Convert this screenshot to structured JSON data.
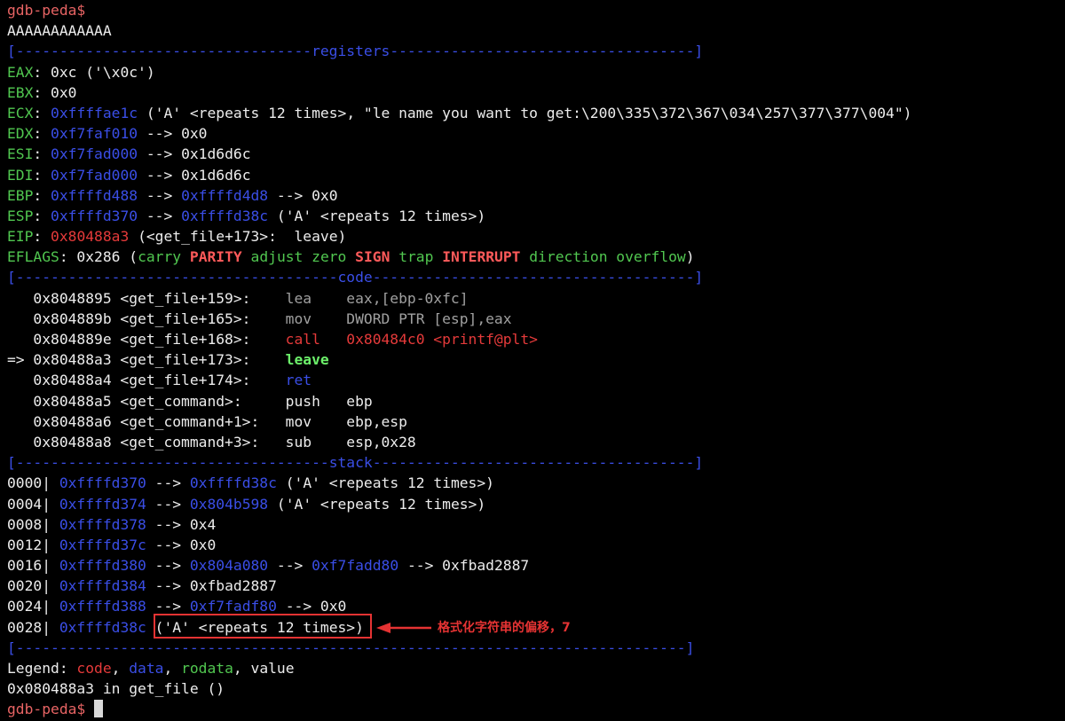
{
  "colors": {
    "default": "#ececec",
    "prompt": "#e86464",
    "green": "#51c750",
    "blue": "#3a4ee6",
    "red": "#e53a3a",
    "dim": "#a0a0a0",
    "bright_green": "#6cf06a",
    "bright_red": "#ff5a5a",
    "annotation": "#e53333"
  },
  "lines": [
    {
      "name": "prompt-line",
      "segs": [
        {
          "t": "gdb-peda$",
          "c": "prompt"
        }
      ]
    },
    {
      "name": "input-echo-line",
      "segs": [
        {
          "t": "AAAAAAAAAAAA",
          "c": "default"
        }
      ]
    },
    {
      "name": "registers-header",
      "segs": [
        {
          "t": "[----------------------------------",
          "c": "blue"
        },
        {
          "t": "registers",
          "c": "blue"
        },
        {
          "t": "-----------------------------------]",
          "c": "blue"
        }
      ]
    },
    {
      "name": "register-eax",
      "segs": [
        {
          "t": "EAX",
          "c": "green"
        },
        {
          "t": ": 0xc ('\\x0c')",
          "c": "default"
        }
      ]
    },
    {
      "name": "register-ebx",
      "segs": [
        {
          "t": "EBX",
          "c": "green"
        },
        {
          "t": ": 0x0",
          "c": "default"
        }
      ]
    },
    {
      "name": "register-ecx",
      "segs": [
        {
          "t": "ECX",
          "c": "green"
        },
        {
          "t": ": ",
          "c": "default"
        },
        {
          "t": "0xffffae1c",
          "c": "blue"
        },
        {
          "t": " ('A' <repeats 12 times>, \"le name you want to get:\\200\\335\\372\\367\\034\\257\\377\\377\\004\")",
          "c": "default"
        }
      ]
    },
    {
      "name": "register-edx",
      "segs": [
        {
          "t": "EDX",
          "c": "green"
        },
        {
          "t": ": ",
          "c": "default"
        },
        {
          "t": "0xf7faf010",
          "c": "blue"
        },
        {
          "t": " --> 0x0",
          "c": "default"
        }
      ]
    },
    {
      "name": "register-esi",
      "segs": [
        {
          "t": "ESI",
          "c": "green"
        },
        {
          "t": ": ",
          "c": "default"
        },
        {
          "t": "0xf7fad000",
          "c": "blue"
        },
        {
          "t": " --> 0x1d6d6c",
          "c": "default"
        }
      ]
    },
    {
      "name": "register-edi",
      "segs": [
        {
          "t": "EDI",
          "c": "green"
        },
        {
          "t": ": ",
          "c": "default"
        },
        {
          "t": "0xf7fad000",
          "c": "blue"
        },
        {
          "t": " --> 0x1d6d6c",
          "c": "default"
        }
      ]
    },
    {
      "name": "register-ebp",
      "segs": [
        {
          "t": "EBP",
          "c": "green"
        },
        {
          "t": ": ",
          "c": "default"
        },
        {
          "t": "0xffffd488",
          "c": "blue"
        },
        {
          "t": " --> ",
          "c": "default"
        },
        {
          "t": "0xffffd4d8",
          "c": "blue"
        },
        {
          "t": " --> 0x0",
          "c": "default"
        }
      ]
    },
    {
      "name": "register-esp",
      "segs": [
        {
          "t": "ESP",
          "c": "green"
        },
        {
          "t": ": ",
          "c": "default"
        },
        {
          "t": "0xffffd370",
          "c": "blue"
        },
        {
          "t": " --> ",
          "c": "default"
        },
        {
          "t": "0xffffd38c",
          "c": "blue"
        },
        {
          "t": " ('A' <repeats 12 times>)",
          "c": "default"
        }
      ]
    },
    {
      "name": "register-eip",
      "segs": [
        {
          "t": "EIP",
          "c": "green"
        },
        {
          "t": ": ",
          "c": "default"
        },
        {
          "t": "0x80488a3",
          "c": "red"
        },
        {
          "t": " (<get_file+173>:  leave)",
          "c": "default"
        }
      ]
    },
    {
      "name": "register-eflags",
      "segs": [
        {
          "t": "EFLAGS",
          "c": "green"
        },
        {
          "t": ": 0x286 (",
          "c": "default"
        },
        {
          "t": "carry",
          "c": "green"
        },
        {
          "t": " ",
          "c": "default"
        },
        {
          "t": "PARITY",
          "c": "bright_red",
          "b": true
        },
        {
          "t": " ",
          "c": "default"
        },
        {
          "t": "adjust zero",
          "c": "green"
        },
        {
          "t": " ",
          "c": "default"
        },
        {
          "t": "SIGN",
          "c": "bright_red",
          "b": true
        },
        {
          "t": " ",
          "c": "default"
        },
        {
          "t": "trap",
          "c": "green"
        },
        {
          "t": " ",
          "c": "default"
        },
        {
          "t": "INTERRUPT",
          "c": "bright_red",
          "b": true
        },
        {
          "t": " ",
          "c": "default"
        },
        {
          "t": "direction overflow",
          "c": "green"
        },
        {
          "t": ")",
          "c": "default"
        }
      ]
    },
    {
      "name": "code-header",
      "segs": [
        {
          "t": "[-------------------------------------",
          "c": "blue"
        },
        {
          "t": "code",
          "c": "blue"
        },
        {
          "t": "-------------------------------------]",
          "c": "blue"
        }
      ]
    },
    {
      "name": "code-line",
      "segs": [
        {
          "t": "   0x8048895 <get_file+159>:    ",
          "c": "default"
        },
        {
          "t": "lea    eax,[ebp-0xfc]",
          "c": "dim"
        }
      ]
    },
    {
      "name": "code-line",
      "segs": [
        {
          "t": "   0x804889b <get_file+165>:    ",
          "c": "default"
        },
        {
          "t": "mov    DWORD PTR [esp],eax",
          "c": "dim"
        }
      ]
    },
    {
      "name": "code-line",
      "segs": [
        {
          "t": "   0x804889e <get_file+168>:    ",
          "c": "default"
        },
        {
          "t": "call   0x80484c0 <printf@plt>",
          "c": "red"
        }
      ]
    },
    {
      "name": "code-line-current",
      "segs": [
        {
          "t": "=> 0x80488a3 <get_file+173>:    ",
          "c": "default"
        },
        {
          "t": "leave",
          "c": "bright_green",
          "b": true
        }
      ]
    },
    {
      "name": "code-line",
      "segs": [
        {
          "t": "   0x80488a4 <get_file+174>:    ",
          "c": "default"
        },
        {
          "t": "ret",
          "c": "blue"
        }
      ]
    },
    {
      "name": "code-line",
      "segs": [
        {
          "t": "   0x80488a5 <get_command>:     push   ebp",
          "c": "default"
        }
      ]
    },
    {
      "name": "code-line",
      "segs": [
        {
          "t": "   0x80488a6 <get_command+1>:   mov    ebp,esp",
          "c": "default"
        }
      ]
    },
    {
      "name": "code-line",
      "segs": [
        {
          "t": "   0x80488a8 <get_command+3>:   sub    esp,0x28",
          "c": "default"
        }
      ]
    },
    {
      "name": "stack-header",
      "segs": [
        {
          "t": "[------------------------------------",
          "c": "blue"
        },
        {
          "t": "stack",
          "c": "blue"
        },
        {
          "t": "-------------------------------------]",
          "c": "blue"
        }
      ]
    },
    {
      "name": "stack-line",
      "segs": [
        {
          "t": "0000| ",
          "c": "default"
        },
        {
          "t": "0xffffd370",
          "c": "blue"
        },
        {
          "t": " --> ",
          "c": "default"
        },
        {
          "t": "0xffffd38c",
          "c": "blue"
        },
        {
          "t": " ('A' <repeats 12 times>)",
          "c": "default"
        }
      ]
    },
    {
      "name": "stack-line",
      "segs": [
        {
          "t": "0004| ",
          "c": "default"
        },
        {
          "t": "0xffffd374",
          "c": "blue"
        },
        {
          "t": " --> ",
          "c": "default"
        },
        {
          "t": "0x804b598",
          "c": "blue"
        },
        {
          "t": " ('A' <repeats 12 times>)",
          "c": "default"
        }
      ]
    },
    {
      "name": "stack-line",
      "segs": [
        {
          "t": "0008| ",
          "c": "default"
        },
        {
          "t": "0xffffd378",
          "c": "blue"
        },
        {
          "t": " --> 0x4",
          "c": "default"
        }
      ]
    },
    {
      "name": "stack-line",
      "segs": [
        {
          "t": "0012| ",
          "c": "default"
        },
        {
          "t": "0xffffd37c",
          "c": "blue"
        },
        {
          "t": " --> 0x0",
          "c": "default"
        }
      ]
    },
    {
      "name": "stack-line",
      "segs": [
        {
          "t": "0016| ",
          "c": "default"
        },
        {
          "t": "0xffffd380",
          "c": "blue"
        },
        {
          "t": " --> ",
          "c": "default"
        },
        {
          "t": "0x804a080",
          "c": "blue"
        },
        {
          "t": " --> ",
          "c": "default"
        },
        {
          "t": "0xf7fadd80",
          "c": "blue"
        },
        {
          "t": " --> 0xfbad2887",
          "c": "default"
        }
      ]
    },
    {
      "name": "stack-line",
      "segs": [
        {
          "t": "0020| ",
          "c": "default"
        },
        {
          "t": "0xffffd384",
          "c": "blue"
        },
        {
          "t": " --> 0xfbad2887",
          "c": "default"
        }
      ]
    },
    {
      "name": "stack-line",
      "segs": [
        {
          "t": "0024| ",
          "c": "default"
        },
        {
          "t": "0xffffd388",
          "c": "blue"
        },
        {
          "t": " --> ",
          "c": "default"
        },
        {
          "t": "0xf7fadf80",
          "c": "blue"
        },
        {
          "t": " --> 0x0",
          "c": "default"
        }
      ]
    },
    {
      "name": "stack-line-highlighted",
      "segs": [
        {
          "t": "0028| ",
          "c": "default"
        },
        {
          "t": "0xffffd38c",
          "c": "blue"
        },
        {
          "t": " ('A' <repeats 12 times>)",
          "c": "default"
        }
      ]
    },
    {
      "name": "footer-divider",
      "segs": [
        {
          "t": "[-----------------------------------------------------------------------------]",
          "c": "blue"
        }
      ]
    },
    {
      "name": "legend-line",
      "segs": [
        {
          "t": "Legend: ",
          "c": "default"
        },
        {
          "t": "code",
          "c": "red"
        },
        {
          "t": ", ",
          "c": "default"
        },
        {
          "t": "data",
          "c": "blue"
        },
        {
          "t": ", ",
          "c": "default"
        },
        {
          "t": "rodata",
          "c": "green"
        },
        {
          "t": ", value",
          "c": "default"
        }
      ]
    },
    {
      "name": "location-line",
      "segs": [
        {
          "t": "0x080488a3 in get_file ()",
          "c": "default"
        }
      ]
    },
    {
      "name": "prompt-line-active",
      "segs": [
        {
          "t": "gdb-peda$",
          "c": "prompt"
        },
        {
          "t": " ",
          "c": "default"
        }
      ],
      "cursor": true
    }
  ],
  "annotation": {
    "text": "格式化字符串的偏移，7"
  }
}
